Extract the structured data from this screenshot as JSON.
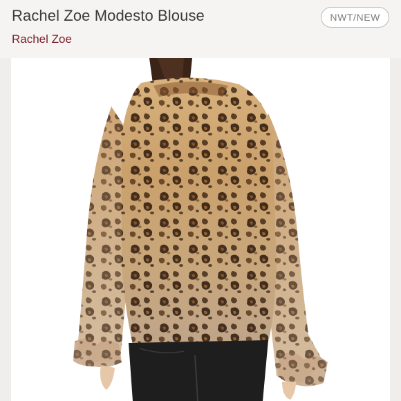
{
  "listing": {
    "title": "Rachel Zoe Modesto Blouse",
    "brand": "Rachel Zoe",
    "condition": "NWT/NEW"
  },
  "colors": {
    "brand": "#7a1e2c",
    "background": "#f6f4f3",
    "badge_border": "#b9b9b9"
  }
}
